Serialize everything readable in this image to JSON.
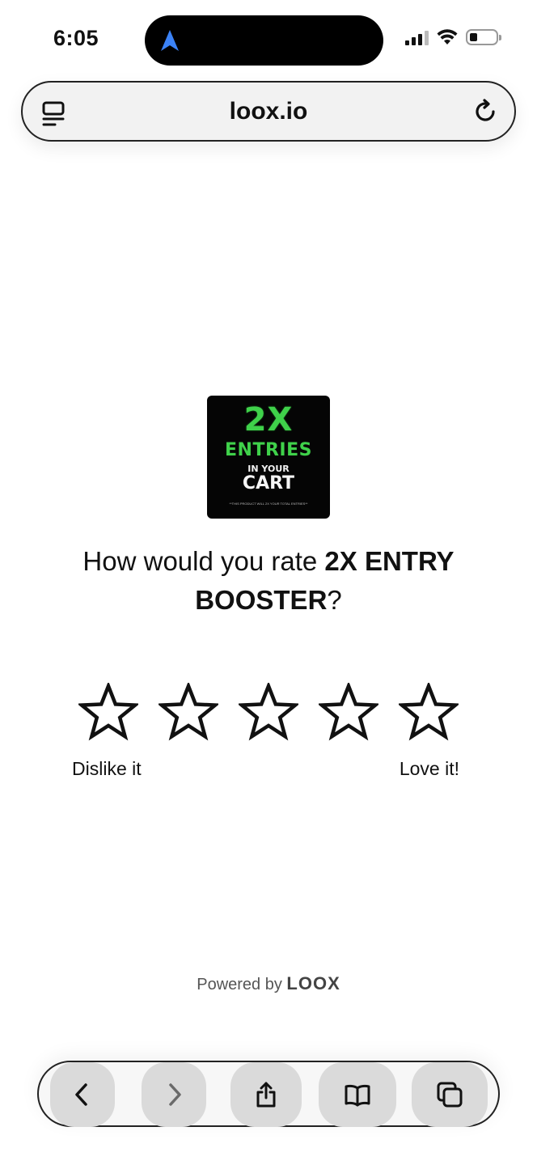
{
  "status_bar": {
    "time": "6:05",
    "location_icon": "navigation-arrow-icon",
    "signal_icon": "cellular-signal-icon",
    "wifi_icon": "wifi-icon",
    "battery_icon": "battery-low-icon"
  },
  "url_bar": {
    "url": "loox.io",
    "left_icon": "reader-mode-icon",
    "right_icon": "reload-icon"
  },
  "product": {
    "image_text": {
      "big": "2X",
      "mid": "ENTRIES",
      "small": "IN YOUR",
      "cart": "CART",
      "tiny": "**THIS PRODUCT WILL 2X YOUR TOTAL ENTRIES**"
    },
    "question_prefix": "How would you rate ",
    "product_name": "2X ENTRY BOOSTER",
    "question_suffix": "?"
  },
  "rating": {
    "star_count": 5,
    "selected": 0,
    "label_low": "Dislike it",
    "label_high": "Love it!",
    "star_icon": "star-outline-icon"
  },
  "footer": {
    "powered_by": "Powered by",
    "brand": "LOOX"
  },
  "toolbar": {
    "items": [
      "back-icon",
      "forward-icon",
      "share-icon",
      "bookmarks-icon",
      "tabs-icon"
    ]
  },
  "colors": {
    "accent_location": "#3b82f6",
    "image_green": "#3fd14a",
    "toolbar_button": "#dadada"
  }
}
